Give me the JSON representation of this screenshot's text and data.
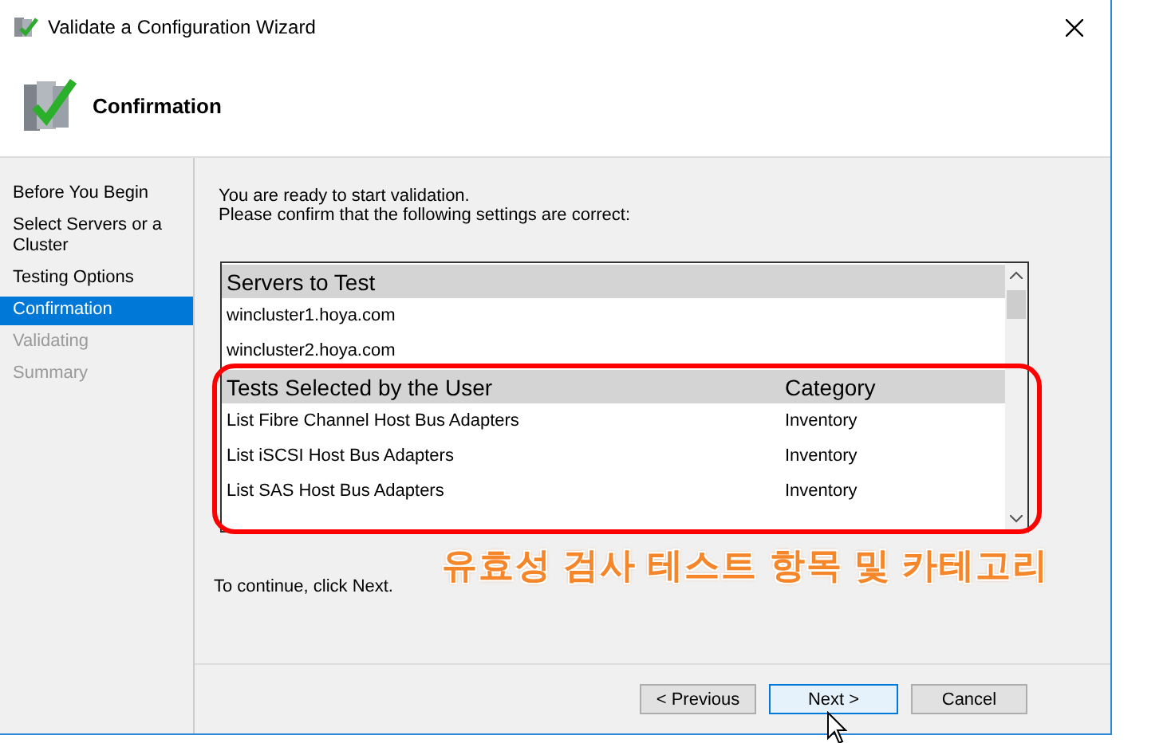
{
  "window": {
    "title": "Validate a Configuration Wizard"
  },
  "header": {
    "title": "Confirmation"
  },
  "sidebar": {
    "items": [
      {
        "label": "Before You Begin",
        "selected": false,
        "disabled": false
      },
      {
        "label": "Select Servers or a Cluster",
        "selected": false,
        "disabled": false
      },
      {
        "label": "Testing Options",
        "selected": false,
        "disabled": false
      },
      {
        "label": "Confirmation",
        "selected": true,
        "disabled": false
      },
      {
        "label": "Validating",
        "selected": false,
        "disabled": true
      },
      {
        "label": "Summary",
        "selected": false,
        "disabled": true
      }
    ]
  },
  "intro": [
    "You are ready to start validation.",
    "Please confirm that the following settings are correct:"
  ],
  "list": {
    "sections": [
      {
        "columns": [
          "Servers to Test"
        ],
        "rows": [
          [
            "wincluster1.hoya.com"
          ],
          [
            "wincluster2.hoya.com"
          ]
        ]
      },
      {
        "columns": [
          "Tests Selected by the User",
          "Category"
        ],
        "rows": [
          [
            "List Fibre Channel Host Bus Adapters",
            "Inventory"
          ],
          [
            "List iSCSI Host Bus Adapters",
            "Inventory"
          ],
          [
            "List SAS Host Bus Adapters",
            "Inventory"
          ]
        ]
      }
    ]
  },
  "footer_note": "To continue, click Next.",
  "buttons": [
    {
      "label": "< Previous",
      "focused": false
    },
    {
      "label": "Next >",
      "focused": true
    },
    {
      "label": "Cancel",
      "focused": false
    }
  ],
  "annotation": {
    "text": "유효성 검사 테스트 항목 및 카테고리"
  }
}
